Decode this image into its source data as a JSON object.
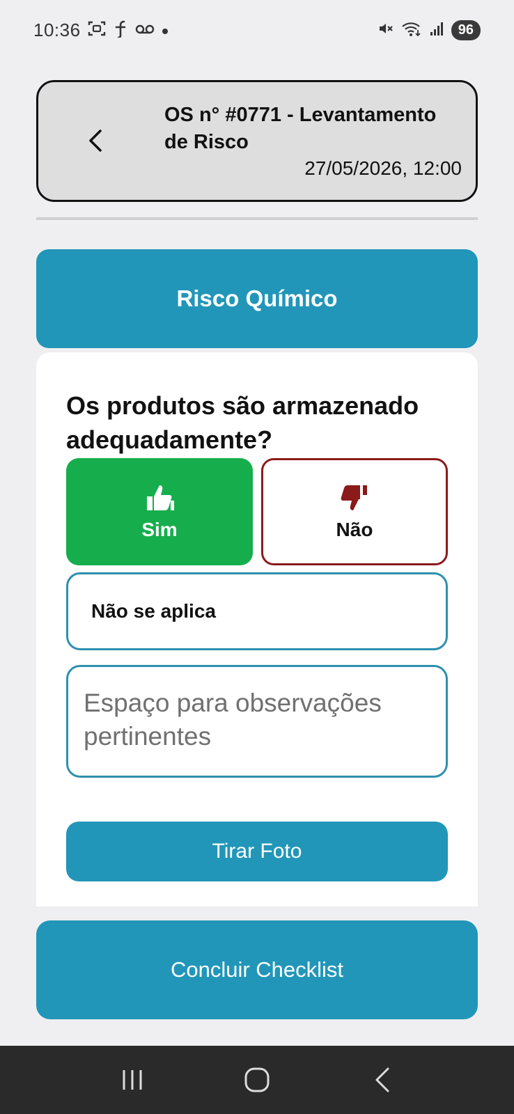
{
  "status_bar": {
    "time": "10:36",
    "battery": "96",
    "icons": [
      "screenshot-icon",
      "f-icon",
      "voicemail-icon",
      "dot-icon",
      "mute-icon",
      "wifi-icon",
      "signal-icon"
    ]
  },
  "header": {
    "title": "OS n° #0771 - Levantamento de Risco",
    "datetime": "27/05/2026, 12:00"
  },
  "section": {
    "label": "Risco Químico"
  },
  "question": {
    "text": "Os produtos são armazenado adequadamente?",
    "options": {
      "yes": "Sim",
      "no": "Não",
      "not_applicable": "Não se aplica"
    },
    "selected": "Sim",
    "observations_placeholder": "Espaço para observações pertinentes",
    "photo_button": "Tirar Foto"
  },
  "footer": {
    "finish_button": "Concluir Checklist"
  },
  "colors": {
    "primary": "#2196b8",
    "yes_selected": "#16ae4d",
    "no_border": "#8b1a1a",
    "option_border": "#2e8fae"
  }
}
